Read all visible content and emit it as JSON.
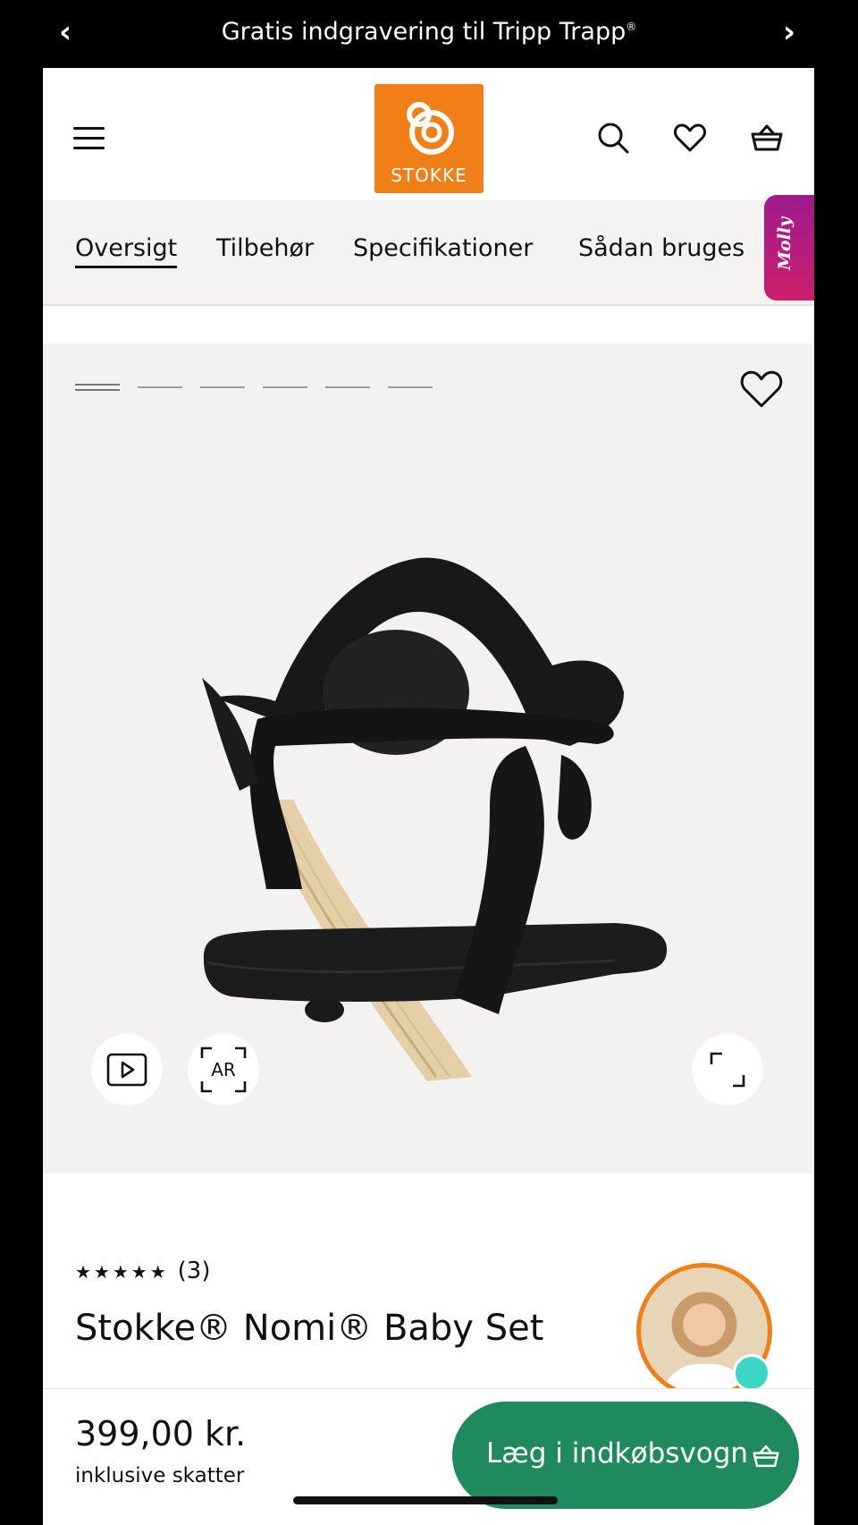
{
  "promo": {
    "text": "Gratis indgravering til Tripp Trapp",
    "mark": "®",
    "prev": "‹",
    "next": "›"
  },
  "header": {
    "logo_text": "STOKKE",
    "icons": [
      "menu-icon",
      "search-icon",
      "heart-icon",
      "basket-icon"
    ]
  },
  "tabs": [
    {
      "label": "Oversigt",
      "active": true
    },
    {
      "label": "Tilbehør",
      "active": false
    },
    {
      "label": "Specifikationer",
      "active": false
    },
    {
      "label": "Sådan bruges",
      "active": false
    }
  ],
  "molly": {
    "label": "Molly"
  },
  "gallery": {
    "slide_count": 6,
    "active_slide": 1,
    "ar_label": "AR",
    "icons": [
      "heart-icon",
      "play-icon",
      "ar-icon",
      "expand-icon"
    ]
  },
  "product": {
    "stars": "★★★★★",
    "reviews": "(3)",
    "title": "Stokke® Nomi® Baby Set"
  },
  "purchase": {
    "price": "399,00 kr.",
    "tax_note": "inklusive skatter",
    "cta": "Læg i indkøbsvogn"
  },
  "colors": {
    "brand": "#f07f17",
    "cta": "#1f8a5c",
    "molly_start": "#9e1b8f",
    "molly_end": "#cc1f6a"
  }
}
